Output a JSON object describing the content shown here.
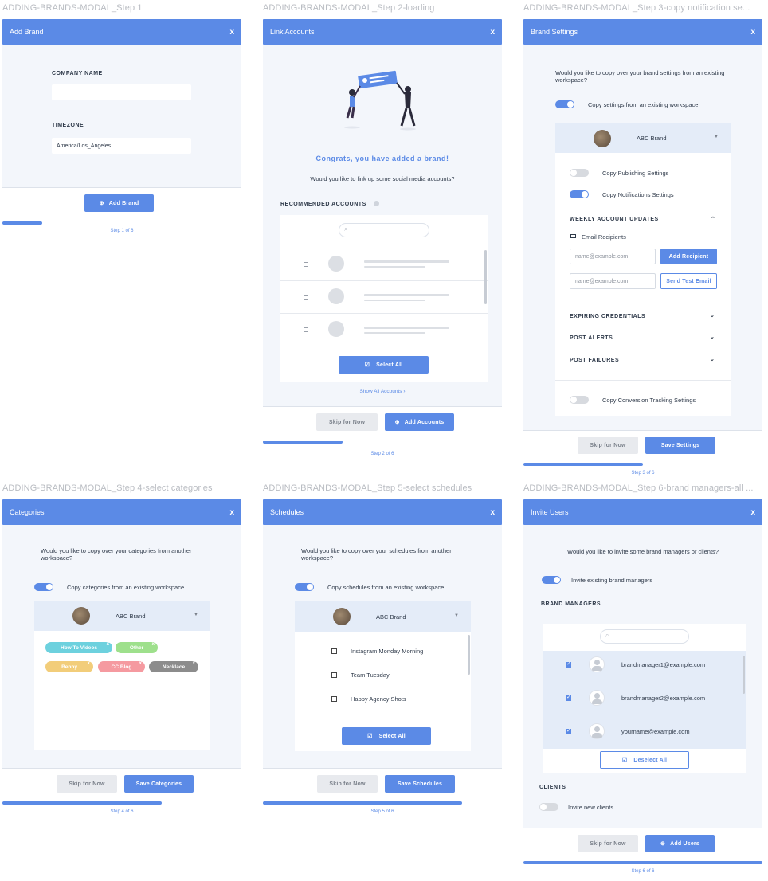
{
  "colors": {
    "accent": "#5b8ae6",
    "panel": "#f3f6fb",
    "tag_how_to": "#6dd1de",
    "tag_other": "#9ee08c",
    "tag_benny": "#f2cd7a",
    "tag_cc_blog": "#f59aa0",
    "tag_necklace": "#8c8c8c"
  },
  "f1": {
    "title": "ADDING-BRANDS-MODAL_Step 1",
    "header": "Add Brand",
    "close": "x",
    "company_label": "COMPANY NAME",
    "company_value": "",
    "timezone_label": "TIMEZONE",
    "timezone_value": "America/Los_Angeles",
    "btn_add": "Add Brand",
    "step": "Step 1 of 6",
    "progress": 0.1667
  },
  "f2": {
    "title": "ADDING-BRANDS-MODAL_Step 2-loading",
    "header": "Link Accounts",
    "close": "x",
    "congrats": "Congrats, you have added a brand!",
    "question": "Would you like to link up some social media accounts?",
    "rec_label": "RECOMMENDED ACCOUNTS",
    "select_all": "Select All",
    "show_all": "Show All Accounts",
    "btn_skip": "Skip for Now",
    "btn_add": "Add Accounts",
    "step": "Step 2 of 6",
    "progress": 0.3333
  },
  "f3": {
    "title": "ADDING-BRANDS-MODAL_Step 3-copy notification se...",
    "header": "Brand Settings",
    "close": "x",
    "question": "Would you like to copy over your brand settings from an existing workspace?",
    "toggle_label": "Copy settings from an existing workspace",
    "brand": "ABC Brand",
    "publishing": "Copy Publishing Settings",
    "notifications": "Copy Notifications Settings",
    "weekly": "WEEKLY ACCOUNT UPDATES",
    "email_recipients": "Email Recipients",
    "email_ph1": "name@example.com",
    "email_ph2": "name@example.com",
    "btn_add_recipient": "Add Recipient",
    "btn_test": "Send Test Email",
    "expiring": "EXPIRING CREDENTIALS",
    "post_alerts": "POST ALERTS",
    "post_failures": "POST FAILURES",
    "conversion": "Copy Conversion Tracking Settings",
    "btn_skip": "Skip for Now",
    "btn_save": "Save Settings",
    "step": "Step 3 of 6",
    "progress": 0.5
  },
  "f4": {
    "title": "ADDING-BRANDS-MODAL_Step 4-select categories",
    "header": "Categories",
    "close": "x",
    "question": "Would you like to copy over your categories from another workspace?",
    "toggle_label": "Copy categories from an existing workspace",
    "brand": "ABC Brand",
    "tags": [
      "How To Videos",
      "Other",
      "Benny",
      "CC Blog",
      "Necklace"
    ],
    "tag_close": "x",
    "btn_skip": "Skip for Now",
    "btn_save": "Save Categories",
    "step": "Step 4 of 6",
    "progress": 0.6667
  },
  "f5": {
    "title": "ADDING-BRANDS-MODAL_Step 5-select schedules",
    "header": "Schedules",
    "close": "x",
    "question": "Would you like to copy over your schedules from another workspace?",
    "toggle_label": "Copy schedules from an existing workspace",
    "brand": "ABC Brand",
    "schedules": [
      "Instagram Monday Morning",
      "Team Tuesday",
      "Happy Agency Shots"
    ],
    "select_all": "Select All",
    "btn_skip": "Skip for Now",
    "btn_save": "Save Schedules",
    "step": "Step 5 of 6",
    "progress": 0.8333
  },
  "f6": {
    "title": "ADDING-BRANDS-MODAL_Step 6-brand managers-all ...",
    "header": "Invite Users",
    "close": "x",
    "question": "Would you like to invite some brand managers or clients?",
    "toggle_label": "Invite existing brand managers",
    "managers_label": "BRAND MANAGERS",
    "managers": [
      "brandmanager1@example.com",
      "brandmanager2@example.com",
      "yourname@example.com"
    ],
    "deselect": "Deselect All",
    "clients_label": "CLIENTS",
    "clients_toggle": "Invite new clients",
    "btn_skip": "Skip for Now",
    "btn_add": "Add Users",
    "step": "Step 6 of 6",
    "progress": 1.0
  }
}
